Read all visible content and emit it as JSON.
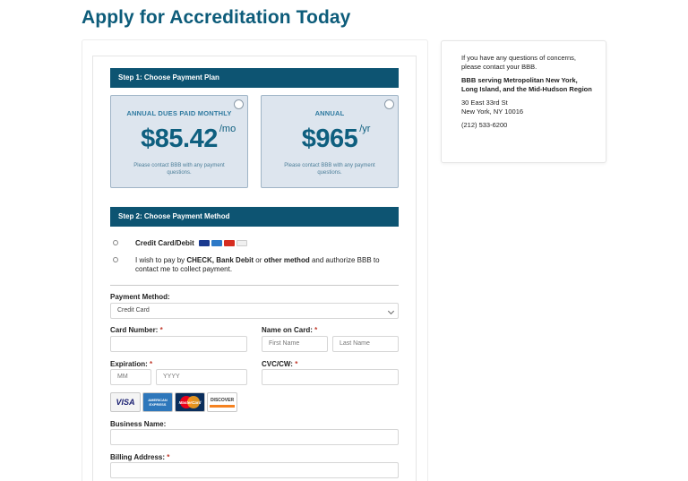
{
  "page": {
    "title": "Apply for Accreditation Today"
  },
  "step1": {
    "label": "Step 1: Choose Payment Plan",
    "plans": [
      {
        "name": "ANNUAL DUES PAID MONTHLY",
        "price": "$85.42",
        "unit": "/mo",
        "note": "Please contact BBB with any payment questions.",
        "selected": false
      },
      {
        "name": "ANNUAL",
        "price": "$965",
        "unit": "/yr",
        "note": "Please contact BBB with any payment questions.",
        "selected": false
      }
    ]
  },
  "step2": {
    "label": "Step 2: Choose Payment Method",
    "option_card": "Credit Card/Debit",
    "option_other": {
      "part1": "I wish to pay by ",
      "bold1": "CHECK, Bank Debit",
      "part2": " or ",
      "bold2": "other method",
      "part3": " and authorize BBB to contact me to collect payment."
    }
  },
  "form": {
    "payment_method": {
      "label": "Payment Method:",
      "value": "Credit Card"
    },
    "card_number": {
      "label": "Card Number:",
      "value": ""
    },
    "name_on_card": {
      "label": "Name on Card:",
      "first_placeholder": "First Name",
      "last_placeholder": "Last Name"
    },
    "expiration": {
      "label": "Expiration:",
      "month_placeholder": "MM",
      "year_placeholder": "YYYY"
    },
    "cvc": {
      "label": "CVC/CW:"
    },
    "required_mark": "*",
    "card_logos": [
      "VISA",
      "AMERICAN EXPRESS",
      "MasterCard",
      "DISCOVER"
    ],
    "business_name": {
      "label": "Business Name:"
    },
    "billing_address": {
      "label": "Billing Address:"
    }
  },
  "sidebar": {
    "intro": "If you have any questions of concerns, please contact your BBB.",
    "org": "BBB serving Metropolitan New York, Long Island, and the Mid-Hudson Region",
    "address1": "30 East 33rd St",
    "address2": "New York, NY 10016",
    "phone": "(212) 533-6200"
  },
  "colors": {
    "brand": "#0d5c7a",
    "step_bar": "#0d5472",
    "plan_bg": "#dde5ee",
    "required": "#c0392b"
  },
  "icons": [
    "visa-icon",
    "amex-icon",
    "mastercard-icon",
    "discover-icon",
    "chevron-down-icon"
  ]
}
